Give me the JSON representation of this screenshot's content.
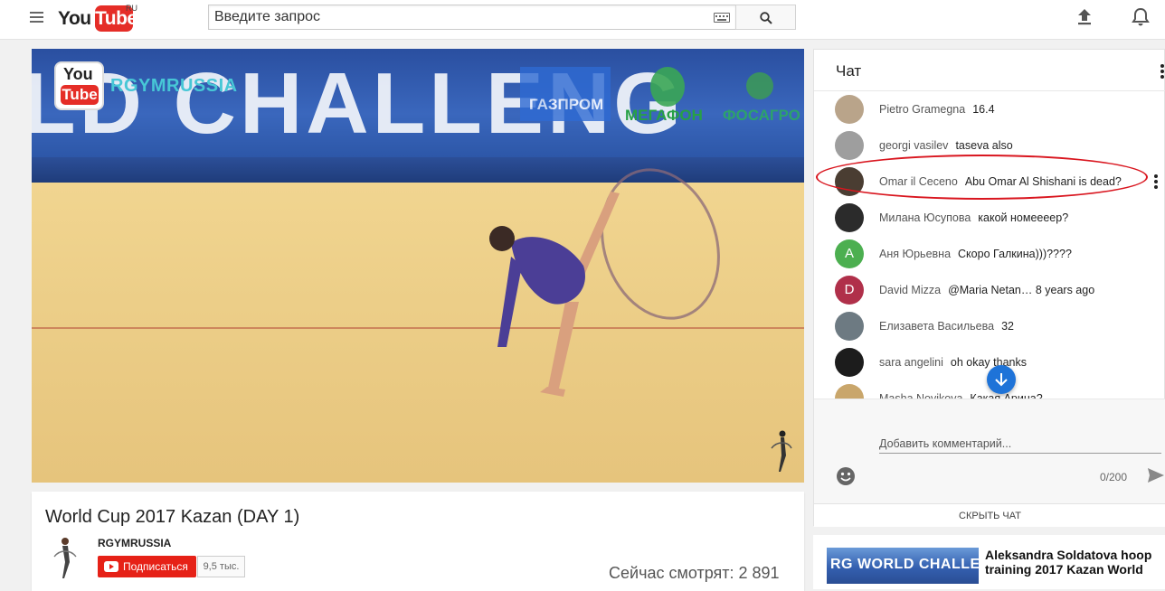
{
  "masthead": {
    "logo_you": "You",
    "logo_tube": "Tube",
    "logo_region": "RU",
    "search_placeholder": "Введите запрос",
    "icons": [
      "menu-icon",
      "keyboard-icon",
      "search-icon",
      "upload-icon",
      "bell-icon"
    ]
  },
  "player": {
    "arena_banner_text": "LD CHALLENG",
    "watermark_you": "You",
    "watermark_tube": "Tube",
    "watermark_channel": "RGYMRUSSIA",
    "sponsors": [
      "ГАЗПРОМ",
      "МЕГАФОН",
      "ФОСАГРО"
    ]
  },
  "video": {
    "title": "World Cup 2017 Kazan (DAY 1)",
    "channel": "RGYMRUSSIA",
    "subscribe_label": "Подписаться",
    "subscriber_count": "9,5 тыс.",
    "viewers_now": "Сейчас смотрят: 2 891"
  },
  "chat": {
    "title": "Чат",
    "messages": [
      {
        "author": "Pietro Gramegna",
        "text": "16.4",
        "avatar_letter": "",
        "avatar_color": "#b9a48a"
      },
      {
        "author": "georgi vasilev",
        "text": "taseva also",
        "avatar_letter": "",
        "avatar_color": "#9e9e9e"
      },
      {
        "author": "Omar il Ceceno",
        "text": "Abu Omar Al Shishani is dead?",
        "avatar_letter": "",
        "avatar_color": "#4a3d32"
      },
      {
        "author": "Милана Юсупова",
        "text": "какой номеееер?",
        "avatar_letter": "",
        "avatar_color": "#2b2b2b"
      },
      {
        "author": "Аня Юрьевна",
        "text": "Скоро Галкина)))????",
        "avatar_letter": "А",
        "avatar_color": "#4caf50"
      },
      {
        "author": "David Mizza",
        "text": "@Maria Netan… 8 years ago",
        "avatar_letter": "D",
        "avatar_color": "#b0304a"
      },
      {
        "author": "Елизавета Васильева",
        "text": "32",
        "avatar_letter": "",
        "avatar_color": "#6d7a82"
      },
      {
        "author": "sara angelini",
        "text": "oh okay thanks",
        "avatar_letter": "",
        "avatar_color": "#1c1c1c"
      },
      {
        "author": "Masha Novikova",
        "text": "Какая Арина?",
        "avatar_letter": "",
        "avatar_color": "#c9a66b"
      }
    ],
    "comment_placeholder": "Добавить комментарий...",
    "char_counter": "0/200",
    "hide_chat_label": "СКРЫТЬ ЧАТ",
    "highlight_color": "#d9161f"
  },
  "related": {
    "thumb_text": "RG WORLD CHALLENG",
    "title": "Aleksandra Soldatova hoop training 2017 Kazan World"
  },
  "colors": {
    "brand_red": "#e52d27",
    "subscribe_red": "#e62117",
    "scroll_blue": "#1e73d8"
  }
}
